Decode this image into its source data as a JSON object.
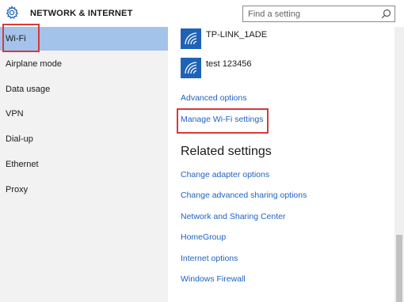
{
  "header": {
    "title": "NETWORK & INTERNET",
    "search_placeholder": "Find a setting",
    "icons": {
      "settings": "gear-icon",
      "search": "search-icon"
    }
  },
  "sidebar": {
    "items": [
      {
        "label": "Wi-Fi",
        "active": true
      },
      {
        "label": "Airplane mode"
      },
      {
        "label": "Data usage"
      },
      {
        "label": "VPN"
      },
      {
        "label": "Dial-up"
      },
      {
        "label": "Ethernet"
      },
      {
        "label": "Proxy"
      }
    ]
  },
  "main": {
    "networks": [
      {
        "name": "TP-LINK_1ADE",
        "icon": "wifi-signal-icon"
      },
      {
        "name": "test 123456",
        "icon": "wifi-signal-icon"
      }
    ],
    "advanced_options": "Advanced options",
    "manage_wifi": "Manage Wi-Fi settings",
    "related_heading": "Related settings",
    "related_links": [
      "Change adapter options",
      "Change advanced sharing options",
      "Network and Sharing Center",
      "HomeGroup",
      "Internet options",
      "Windows Firewall"
    ]
  },
  "colors": {
    "accent": "#1f63b8",
    "link": "#1d62c4",
    "selected": "#a4c3ea",
    "sidebar_bg": "#f2f2f2",
    "highlight": "#d9383a"
  }
}
